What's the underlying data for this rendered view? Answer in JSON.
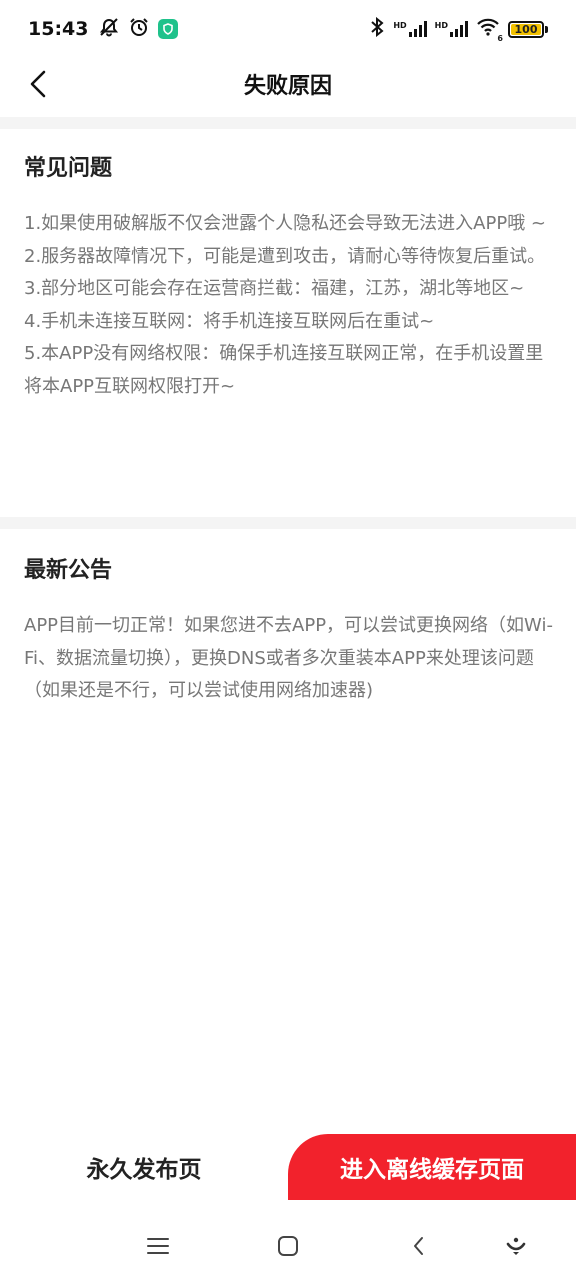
{
  "status_bar": {
    "time": "15:43",
    "battery": "100",
    "hd_label_1": "HD",
    "hd_label_2": "HD",
    "wifi_sub": "6"
  },
  "header": {
    "title": "失败原因"
  },
  "faq": {
    "title": "常见问题",
    "items": [
      "1.如果使用破解版不仅会泄露个人隐私还会导致无法进入APP哦 ~",
      "2.服务器故障情况下，可能是遭到攻击，请耐心等待恢复后重试。",
      "3.部分地区可能会存在运营商拦截：福建，江苏，湖北等地区~",
      "4.手机未连接互联网：将手机连接互联网后在重试~",
      "5.本APP没有网络权限：确保手机连接互联网正常，在手机设置里将本APP互联网权限打开~"
    ]
  },
  "notice": {
    "title": "最新公告",
    "body": "APP目前一切正常！如果您进不去APP，可以尝试更换网络（如Wi-Fi、数据流量切换），更换DNS或者多次重装本APP来处理该问题（如果还是不行，可以尝试使用网络加速器)"
  },
  "buttons": {
    "permanent_label": "永久发布页",
    "offline_label": "进入离线缓存页面"
  },
  "colors": {
    "accent_red": "#f2222c",
    "battery_yellow": "#f2c100",
    "badge_green": "#1fc28b"
  }
}
